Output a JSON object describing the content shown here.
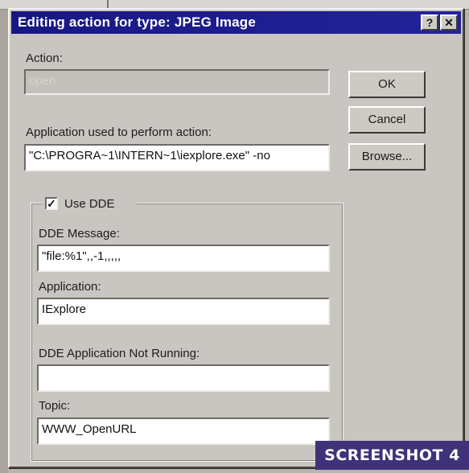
{
  "window": {
    "title": "Editing action for type: JPEG Image",
    "help_glyph": "?",
    "close_glyph": "✕"
  },
  "action": {
    "label": "Action:",
    "value": "open"
  },
  "application": {
    "label": "Application used to perform action:",
    "value": "\"C:\\PROGRA~1\\INTERN~1\\iexplore.exe\" -no"
  },
  "buttons": {
    "ok": "OK",
    "cancel": "Cancel",
    "browse": "Browse..."
  },
  "dde": {
    "checkbox_label": "Use DDE",
    "checked": true,
    "check_glyph": "✓",
    "message_label": "DDE Message:",
    "message_value": "\"file:%1\",,-1,,,,,",
    "application_label": "Application:",
    "application_value": "IExplore",
    "not_running_label": "DDE Application Not Running:",
    "not_running_value": "",
    "topic_label": "Topic:",
    "topic_value": "WWW_OpenURL"
  },
  "badge": "SCREENSHOT 4",
  "colors": {
    "titlebar": "#1a1a8c",
    "dialog_face": "#c9c6c1",
    "badge": "#3f3278"
  }
}
